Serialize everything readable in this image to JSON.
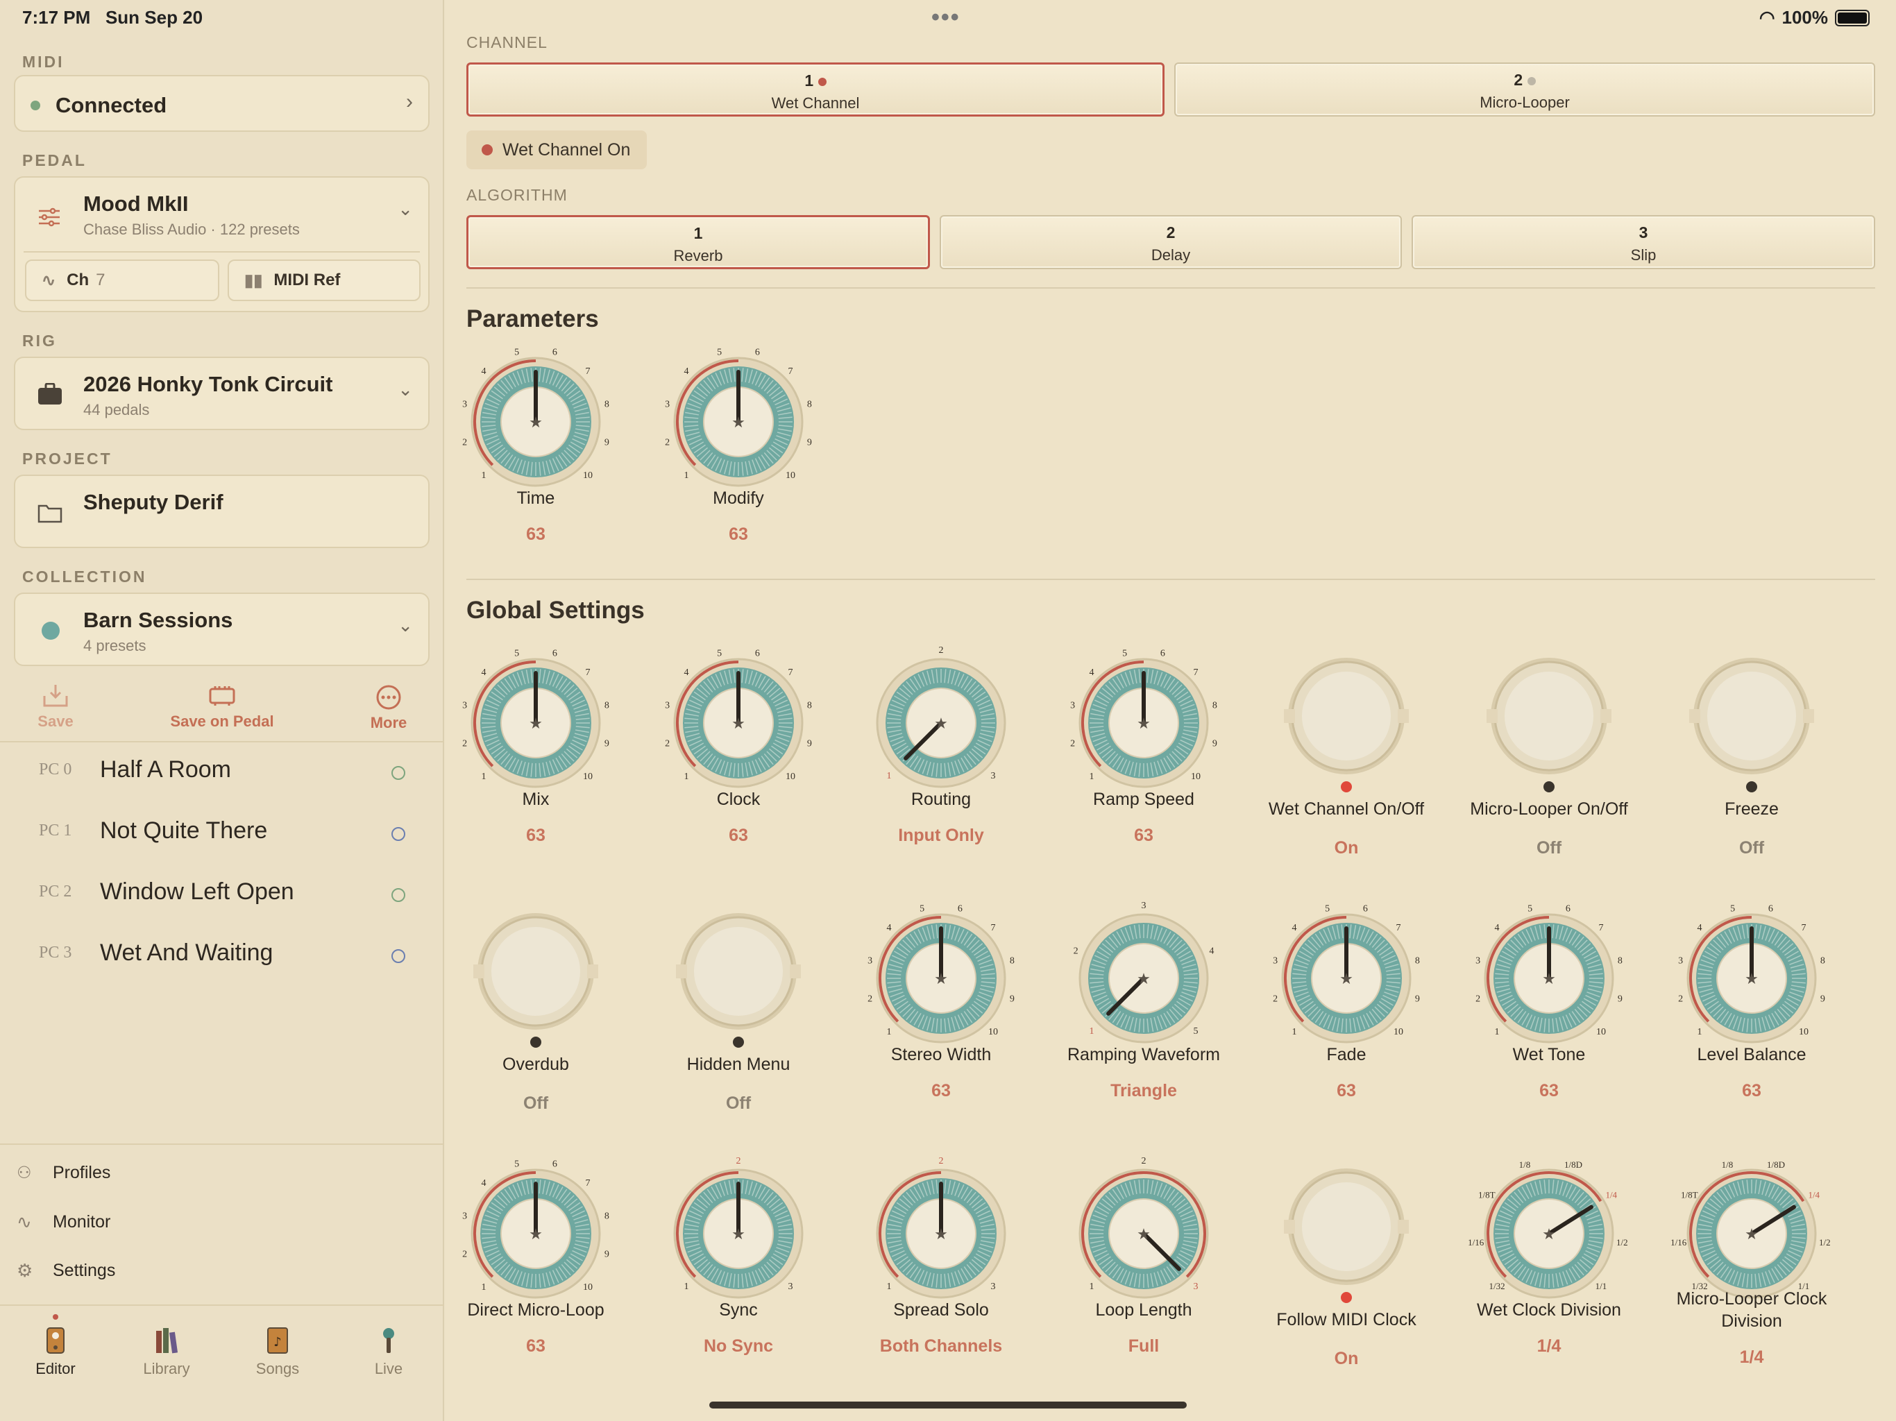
{
  "status": {
    "time": "7:17 PM",
    "date": "Sun Sep 20",
    "battery": "100%"
  },
  "sidebar": {
    "midi": {
      "section": "MIDI",
      "status": "Connected"
    },
    "pedal": {
      "section": "PEDAL",
      "name": "Mood MkII",
      "sub": "Chase Bliss Audio · 122 presets",
      "ch_label": "Ch",
      "ch_value": "7",
      "midi_ref": "MIDI Ref"
    },
    "rig": {
      "section": "RIG",
      "name": "2026 Honky Tonk Circuit",
      "sub": "44 pedals"
    },
    "project": {
      "section": "PROJECT",
      "name": "Sheputy Derif"
    },
    "collection": {
      "section": "COLLECTION",
      "name": "Barn Sessions",
      "sub": "4 presets"
    },
    "actions": {
      "save": "Save",
      "save_on_pedal": "Save on Pedal",
      "more": "More"
    },
    "presets": [
      {
        "pc": "PC 0",
        "name": "Half A Room",
        "color": "#7ea57e"
      },
      {
        "pc": "PC 1",
        "name": "Not Quite There",
        "color": "#6b7fb0"
      },
      {
        "pc": "PC 2",
        "name": "Window Left Open",
        "color": "#7ea57e"
      },
      {
        "pc": "PC 3",
        "name": "Wet And Waiting",
        "color": "#6b7fb0"
      }
    ],
    "bottom": {
      "profiles": "Profiles",
      "monitor": "Monitor",
      "settings": "Settings"
    },
    "tabs": {
      "editor": "Editor",
      "library": "Library",
      "songs": "Songs",
      "live": "Live"
    }
  },
  "main": {
    "channel_label": "CHANNEL",
    "channels": [
      {
        "n": "1",
        "label": "Wet Channel"
      },
      {
        "n": "2",
        "label": "Micro-Looper"
      }
    ],
    "wet_pill": "Wet Channel On",
    "algorithm_label": "ALGORITHM",
    "algorithms": [
      {
        "n": "1",
        "label": "Reverb"
      },
      {
        "n": "2",
        "label": "Delay"
      },
      {
        "n": "3",
        "label": "Slip"
      }
    ],
    "parameters_title": "Parameters",
    "global_title": "Global Settings"
  },
  "knobs": {
    "time": {
      "label": "Time",
      "value": "63"
    },
    "modify": {
      "label": "Modify",
      "value": "63"
    },
    "mix": {
      "label": "Mix",
      "value": "63"
    },
    "clock": {
      "label": "Clock",
      "value": "63"
    },
    "routing": {
      "label": "Routing",
      "value": "Input Only"
    },
    "ramp_speed": {
      "label": "Ramp Speed",
      "value": "63"
    },
    "wet_onoff": {
      "label": "Wet Channel On/Off",
      "value": "On"
    },
    "looper_onoff": {
      "label": "Micro-Looper On/Off",
      "value": "Off"
    },
    "freeze": {
      "label": "Freeze",
      "value": "Off"
    },
    "overdub": {
      "label": "Overdub",
      "value": "Off"
    },
    "hidden_menu": {
      "label": "Hidden Menu",
      "value": "Off"
    },
    "stereo_width": {
      "label": "Stereo Width",
      "value": "63"
    },
    "ramping_waveform": {
      "label": "Ramping Waveform",
      "value": "Triangle"
    },
    "fade": {
      "label": "Fade",
      "value": "63"
    },
    "wet_tone": {
      "label": "Wet Tone",
      "value": "63"
    },
    "level_balance": {
      "label": "Level Balance",
      "value": "63"
    },
    "direct_micro_loop": {
      "label": "Direct Micro-Loop",
      "value": "63"
    },
    "sync": {
      "label": "Sync",
      "value": "No Sync"
    },
    "spread_solo": {
      "label": "Spread Solo",
      "value": "Both Channels"
    },
    "loop_length": {
      "label": "Loop Length",
      "value": "Full"
    },
    "follow_midi": {
      "label": "Follow MIDI Clock",
      "value": "On"
    },
    "wet_clock_div": {
      "label": "Wet Clock Division",
      "value": "1/4"
    },
    "looper_clock_div": {
      "label": "Micro-Looper Clock Division",
      "value": "1/4"
    }
  },
  "knob_specs": {
    "time": {
      "type": "cont",
      "level": 0.5
    },
    "modify": {
      "type": "cont",
      "level": 0.5
    },
    "mix": {
      "type": "cont",
      "level": 0.5
    },
    "clock": {
      "type": "cont",
      "level": 0.5
    },
    "routing": {
      "type": "step",
      "ticks": [
        "1",
        "2",
        "3"
      ],
      "sel": 0
    },
    "ramp_speed": {
      "type": "cont",
      "level": 0.5
    },
    "wet_onoff": {
      "type": "switch",
      "on": true
    },
    "looper_onoff": {
      "type": "switch",
      "on": false
    },
    "freeze": {
      "type": "switch",
      "on": false
    },
    "overdub": {
      "type": "switch",
      "on": false
    },
    "hidden_menu": {
      "type": "switch",
      "on": false
    },
    "stereo_width": {
      "type": "cont",
      "level": 0.5
    },
    "ramping_waveform": {
      "type": "step",
      "ticks": [
        "1",
        "2",
        "3",
        "4",
        "5"
      ],
      "sel": 0
    },
    "fade": {
      "type": "cont",
      "level": 0.5
    },
    "wet_tone": {
      "type": "cont",
      "level": 0.5
    },
    "level_balance": {
      "type": "cont",
      "level": 0.5
    },
    "direct_micro_loop": {
      "type": "cont",
      "level": 0.5
    },
    "sync": {
      "type": "step",
      "ticks": [
        "1",
        "2",
        "3"
      ],
      "sel": 1
    },
    "spread_solo": {
      "type": "step",
      "ticks": [
        "1",
        "2",
        "3"
      ],
      "sel": 1
    },
    "loop_length": {
      "type": "step",
      "ticks": [
        "1",
        "2",
        "3"
      ],
      "sel": 2
    },
    "follow_midi": {
      "type": "switch",
      "on": true
    },
    "wet_clock_div": {
      "type": "step",
      "ticks": [
        "1/32",
        "1/16",
        "1/8T",
        "1/8",
        "1/8D",
        "1/4",
        "1/2",
        "1/1"
      ],
      "sel": 5
    },
    "looper_clock_div": {
      "type": "step",
      "ticks": [
        "1/32",
        "1/16",
        "1/8T",
        "1/8",
        "1/8D",
        "1/4",
        "1/2",
        "1/1"
      ],
      "sel": 5
    }
  },
  "colors": {
    "accent": "#c0584a",
    "teal": "#6fa8a0",
    "value": "#c8735c"
  }
}
